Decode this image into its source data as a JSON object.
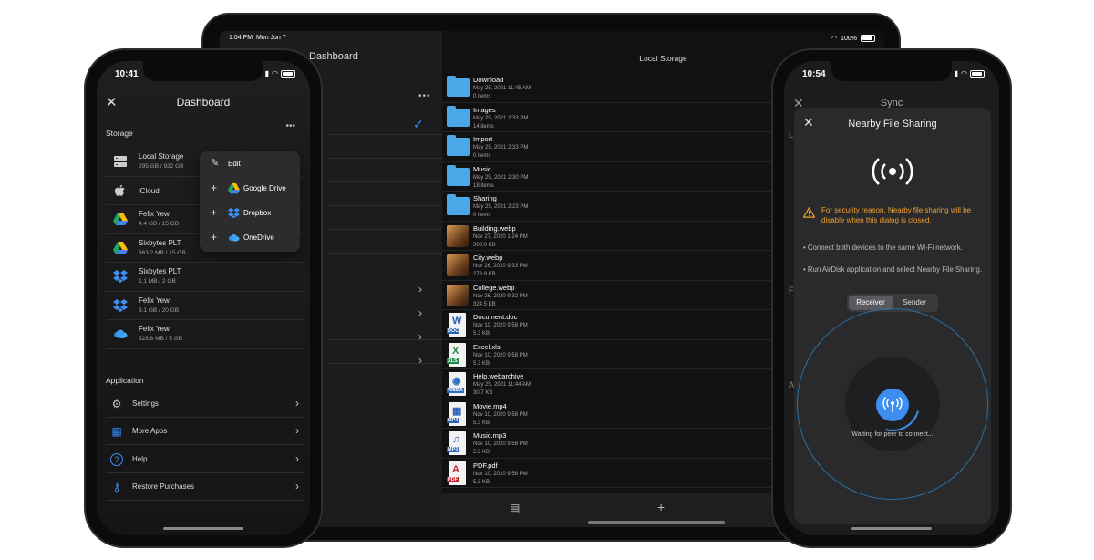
{
  "ipad": {
    "status_time": "1:04 PM",
    "status_date": "Mon Jun 7",
    "battery": "100%",
    "left_title": "Dashboard",
    "main_title": "Local Storage",
    "files": [
      {
        "name": "Download",
        "date": "May 25, 2021 11:45 AM",
        "info": "0 items",
        "kind": "folder"
      },
      {
        "name": "Images",
        "date": "May 25, 2021 2:33 PM",
        "info": "14 items",
        "kind": "folder"
      },
      {
        "name": "Import",
        "date": "May 25, 2021 2:33 PM",
        "info": "0 items",
        "kind": "folder"
      },
      {
        "name": "Music",
        "date": "May 25, 2021 2:30 PM",
        "info": "18 items",
        "kind": "folder"
      },
      {
        "name": "Sharing",
        "date": "May 25, 2021 2:23 PM",
        "info": "0 items",
        "kind": "folder"
      },
      {
        "name": "Building.webp",
        "date": "Nov 27, 2020 1:24 PM",
        "info": "300.0 KB",
        "kind": "image"
      },
      {
        "name": "City.webp",
        "date": "Nov 26, 2020 9:33 PM",
        "info": "278.9 KB",
        "kind": "image"
      },
      {
        "name": "College.webp",
        "date": "Nov 26, 2020 9:32 PM",
        "info": "324.5 KB",
        "kind": "image"
      },
      {
        "name": "Document.doc",
        "date": "Nov 10, 2020 9:58 PM",
        "info": "5.3 KB",
        "kind": "doc",
        "tag": "DOC",
        "glyph": "W",
        "color": "#2b5fb4"
      },
      {
        "name": "Excel.xls",
        "date": "Nov 10, 2020 9:58 PM",
        "info": "5.3 KB",
        "kind": "doc",
        "tag": "XLS",
        "glyph": "X",
        "color": "#1f8a4c"
      },
      {
        "name": "Help.webarchive",
        "date": "May 25, 2021 11:44 AM",
        "info": "30.7 KB",
        "kind": "doc",
        "tag": "WEBA",
        "glyph": "◉",
        "color": "#2b6fc4"
      },
      {
        "name": "Movie.mp4",
        "date": "Nov 10, 2020 9:58 PM",
        "info": "5.3 KB",
        "kind": "doc",
        "tag": "MP4",
        "glyph": "▦",
        "color": "#2b5fb4"
      },
      {
        "name": "Music.mp3",
        "date": "Nov 10, 2020 9:58 PM",
        "info": "5.3 KB",
        "kind": "doc",
        "tag": "MP3",
        "glyph": "♫",
        "color": "#2b5fb4"
      },
      {
        "name": "PDF.pdf",
        "date": "Nov 10, 2020 9:58 PM",
        "info": "5.3 KB",
        "kind": "doc",
        "tag": "PDF",
        "glyph": "A",
        "color": "#c0262d"
      }
    ]
  },
  "phone_left": {
    "time": "10:41",
    "title": "Dashboard",
    "storage_heading": "Storage",
    "storage": [
      {
        "name": "Local Storage",
        "size": "295 GB / 932 GB",
        "icon": "server-icon"
      },
      {
        "name": "iCloud",
        "size": "",
        "icon": "apple-icon"
      },
      {
        "name": "Felix Yew",
        "size": "4.4 GB / 15 GB",
        "icon": "google-drive-icon"
      },
      {
        "name": "Sixbytes PLT",
        "size": "863.2 MB / 15 GB",
        "icon": "google-drive-icon"
      },
      {
        "name": "Sixbytes PLT",
        "size": "1.1 MB / 2 GB",
        "icon": "dropbox-icon"
      },
      {
        "name": "Felix Yew",
        "size": "3.1 GB / 20 GB",
        "icon": "dropbox-icon"
      },
      {
        "name": "Felix Yew",
        "size": "328.8 MB / 5 GB",
        "icon": "onedrive-icon"
      }
    ],
    "application_heading": "Application",
    "app_items": [
      {
        "label": "Settings",
        "icon": "gear-icon"
      },
      {
        "label": "More Apps",
        "icon": "grid-icon"
      },
      {
        "label": "Help",
        "icon": "help-icon"
      },
      {
        "label": "Restore Purchases",
        "icon": "key-icon"
      }
    ],
    "menu": {
      "edit": "Edit",
      "google_drive": "Google Drive",
      "dropbox": "Dropbox",
      "onedrive": "OneDrive"
    }
  },
  "phone_right": {
    "time": "10:54",
    "background_title": "Sync",
    "sheet_title": "Nearby File Sharing",
    "warning": "For security reason, Nearby file sharing will be disable when this dialog is closed.",
    "bullet_1": "• Connect both devices to the same Wi-Fi network.",
    "bullet_2": "• Run AirDisk application and select Nearby File Sharing.",
    "receiver": "Receiver",
    "sender": "Sender",
    "waiting": "Waiting for peer to connect..."
  },
  "colors": {
    "accent": "#3d8ef0",
    "folder": "#4aa8e8",
    "warning": "#f0a030"
  }
}
